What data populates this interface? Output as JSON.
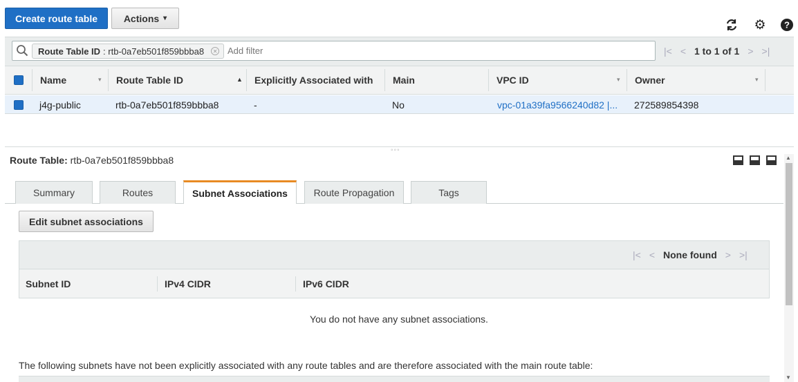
{
  "toolbar": {
    "create_label": "Create route table",
    "actions_label": "Actions",
    "actions_caret": "▾",
    "refresh_icon": "↻",
    "settings_icon": "⚙",
    "help_icon": "?"
  },
  "filter": {
    "token_key": "Route Table ID",
    "token_value": ": rtb-0a7eb501f859bbba8",
    "placeholder": "Add filter",
    "pager_text": "1 to 1 of 1"
  },
  "grid": {
    "columns": [
      "Name",
      "Route Table ID",
      "Explicitly Associated with",
      "Main",
      "VPC ID",
      "Owner"
    ],
    "rows": [
      {
        "name": "j4g-public",
        "route_table_id": "rtb-0a7eb501f859bbba8",
        "explicit": "-",
        "main": "No",
        "vpc_id": "vpc-01a39fa9566240d82 |...",
        "owner": "272589854398"
      }
    ]
  },
  "detail": {
    "title_label": "Route Table:",
    "title_value": "rtb-0a7eb501f859bbba8",
    "tabs": [
      "Summary",
      "Routes",
      "Subnet Associations",
      "Route Propagation",
      "Tags"
    ],
    "active_tab": "Subnet Associations",
    "edit_button": "Edit subnet associations",
    "pager_text": "None found",
    "sub_columns": [
      "Subnet ID",
      "IPv4 CIDR",
      "IPv6 CIDR"
    ],
    "empty_message": "You do not have any subnet associations.",
    "note": "The following subnets have not been explicitly associated with any route tables and are therefore associated with the main route table:"
  },
  "colors": {
    "primary": "#1f6fc5",
    "tab_accent": "#e88a23",
    "selected_row": "#e8f1fb"
  }
}
